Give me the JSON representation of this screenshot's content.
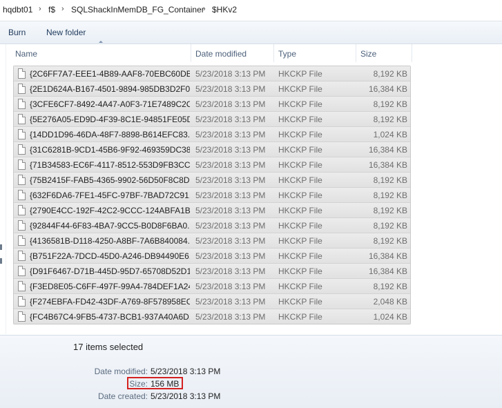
{
  "address_bar": {
    "crumbs": [
      "hqdbt01",
      "f$",
      "SQLShackInMemDB_FG_Container",
      "$HKv2"
    ],
    "separator": "›"
  },
  "toolbar": {
    "burn_label": "Burn",
    "new_folder_label": "New folder"
  },
  "columns": {
    "name": "Name",
    "date_modified": "Date modified",
    "type": "Type",
    "size": "Size"
  },
  "files": [
    {
      "name": "{2C6FF7A7-EEE1-4B89-AAF8-70EBC60DB...",
      "date": "5/23/2018 3:13 PM",
      "type": "HKCKP File",
      "size": "8,192 KB"
    },
    {
      "name": "{2E1D624A-B167-4501-9894-985DB3D2F0...",
      "date": "5/23/2018 3:13 PM",
      "type": "HKCKP File",
      "size": "16,384 KB"
    },
    {
      "name": "{3CFE6CF7-8492-4A47-A0F3-71E7489C2C...",
      "date": "5/23/2018 3:13 PM",
      "type": "HKCKP File",
      "size": "8,192 KB"
    },
    {
      "name": "{5E276A05-ED9D-4F39-8C1E-94851FE05D...",
      "date": "5/23/2018 3:13 PM",
      "type": "HKCKP File",
      "size": "8,192 KB"
    },
    {
      "name": "{14DD1D96-46DA-48F7-8898-B614EFC83...",
      "date": "5/23/2018 3:13 PM",
      "type": "HKCKP File",
      "size": "1,024 KB"
    },
    {
      "name": "{31C6281B-9CD1-45B6-9F92-469359DC38...",
      "date": "5/23/2018 3:13 PM",
      "type": "HKCKP File",
      "size": "16,384 KB"
    },
    {
      "name": "{71B34583-EC6F-4117-8512-553D9FB3CC...",
      "date": "5/23/2018 3:13 PM",
      "type": "HKCKP File",
      "size": "16,384 KB"
    },
    {
      "name": "{75B2415F-FAB5-4365-9902-56D50F8C8D...",
      "date": "5/23/2018 3:13 PM",
      "type": "HKCKP File",
      "size": "8,192 KB"
    },
    {
      "name": "{632F6DA6-7FE1-45FC-97BF-7BAD72C91...",
      "date": "5/23/2018 3:13 PM",
      "type": "HKCKP File",
      "size": "8,192 KB"
    },
    {
      "name": "{2790E4CC-192F-42C2-9CCC-124ABFA1B...",
      "date": "5/23/2018 3:13 PM",
      "type": "HKCKP File",
      "size": "8,192 KB"
    },
    {
      "name": "{92844F44-6F83-4BA7-9CC5-B0D8F6BA0...",
      "date": "5/23/2018 3:13 PM",
      "type": "HKCKP File",
      "size": "8,192 KB"
    },
    {
      "name": "{4136581B-D118-4250-A8BF-7A6B840084...",
      "date": "5/23/2018 3:13 PM",
      "type": "HKCKP File",
      "size": "8,192 KB"
    },
    {
      "name": "{B751F22A-7DCD-45D0-A246-DB94490E6...",
      "date": "5/23/2018 3:13 PM",
      "type": "HKCKP File",
      "size": "16,384 KB"
    },
    {
      "name": "{D91F6467-D71B-445D-95D7-65708D52D1...",
      "date": "5/23/2018 3:13 PM",
      "type": "HKCKP File",
      "size": "16,384 KB"
    },
    {
      "name": "{F3ED8E05-C6FF-497F-99A4-784DEF1A24...",
      "date": "5/23/2018 3:13 PM",
      "type": "HKCKP File",
      "size": "8,192 KB"
    },
    {
      "name": "{F274EBFA-FD42-43DF-A769-8F578958EC...",
      "date": "5/23/2018 3:13 PM",
      "type": "HKCKP File",
      "size": "2,048 KB"
    },
    {
      "name": "{FC4B67C4-9FB5-4737-BCB1-937A40A6D...",
      "date": "5/23/2018 3:13 PM",
      "type": "HKCKP File",
      "size": "1,024 KB"
    }
  ],
  "details": {
    "selection_text": "17 items selected",
    "date_modified_label": "Date modified:",
    "date_modified_value": "5/23/2018 3:13 PM",
    "size_label": "Size:",
    "size_value": "156 MB",
    "date_created_label": "Date created:",
    "date_created_value": "5/23/2018 3:13 PM"
  },
  "colors": {
    "highlight_box": "#d42020",
    "selection_row": "#e6e6e6",
    "toolbar_text": "#1e395b"
  },
  "icons": [
    "file-icon",
    "sort-ascending-icon",
    "chevron-right-icon"
  ]
}
